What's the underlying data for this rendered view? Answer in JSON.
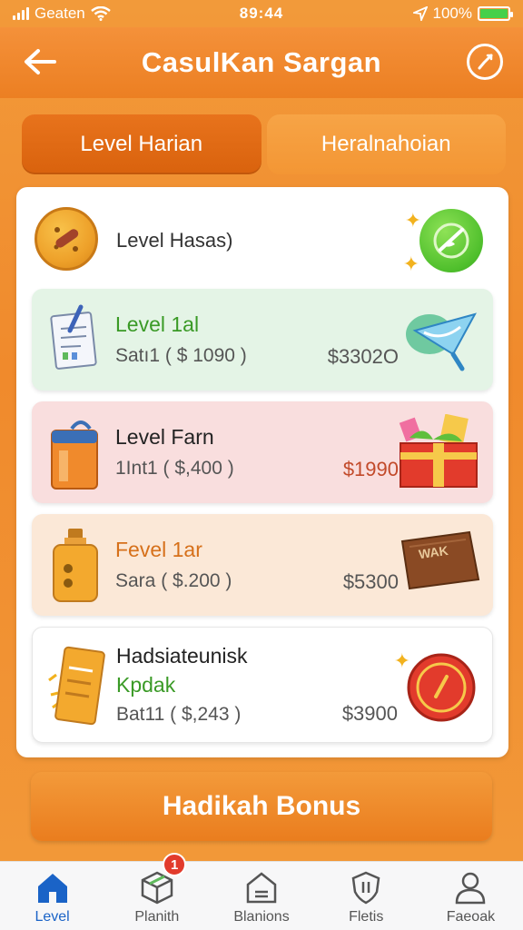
{
  "status_bar": {
    "carrier": "Geaten",
    "time": "89:44",
    "battery": "100%",
    "battery_level": 1.0
  },
  "header": {
    "title": "CasulKan Sargan",
    "back_icon": "arrow-left-icon",
    "action_icon": "compass-icon"
  },
  "tabs": [
    {
      "label": "Level Harian",
      "active": true
    },
    {
      "label": "Heralnahoian",
      "active": false
    }
  ],
  "panel": {
    "header_label": "Level Hasas)",
    "levels": [
      {
        "title": "Level 1al",
        "subtitle": "Satı1 ( $ 1090 )",
        "price": "$3302O",
        "title_color": "#3a9a26",
        "bg": "#e4f4e6"
      },
      {
        "title": "Level Farn",
        "subtitle": "1Int1 ( $,400 )",
        "price": "$1990",
        "title_color": "#222222",
        "bg": "#f9dede"
      },
      {
        "title": "Fevel 1ar",
        "subtitle": "Sara ( $.200 )",
        "price": "$5300",
        "title_color": "#d6701a",
        "bg": "#fbe8d7"
      },
      {
        "title": "Hadsiateunisk",
        "title2": "Kpdak",
        "subtitle": "Bat11 ( $,243 )",
        "price": "$3900",
        "title_color": "#222222",
        "title2_color": "#3a9a26",
        "bg": "#ffffff"
      }
    ],
    "sign_text": "WAK"
  },
  "bonus_button": {
    "label": "Hadikah Bonus"
  },
  "bottom_nav": [
    {
      "label": "Level",
      "icon": "home-icon",
      "active": true
    },
    {
      "label": "Planith",
      "icon": "box-icon",
      "badge": "1"
    },
    {
      "label": "Blanions",
      "icon": "house-icon"
    },
    {
      "label": "Fletis",
      "icon": "shield-icon"
    },
    {
      "label": "Faeoak",
      "icon": "user-icon"
    }
  ]
}
